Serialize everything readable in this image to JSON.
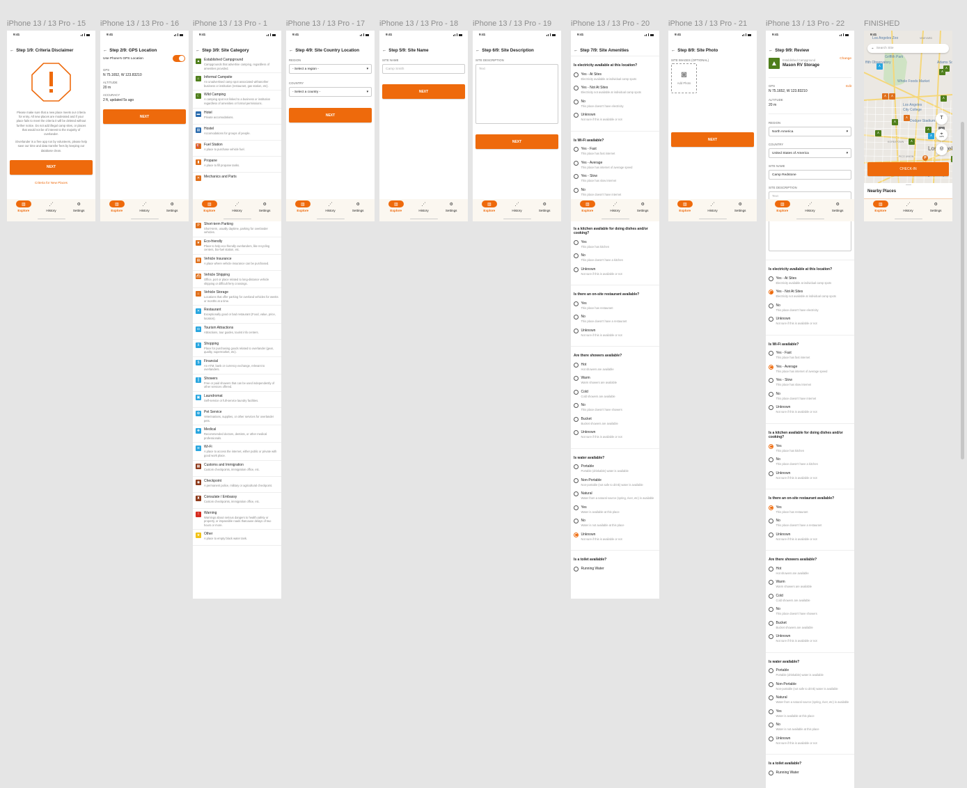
{
  "canvas_bg": "#e5e5e5",
  "accent": "#ee6a0c",
  "status_time": "9:41",
  "nav": [
    {
      "label": "Explore",
      "icon": "map-book-icon",
      "active": true
    },
    {
      "label": "History",
      "icon": "route-icon",
      "active": false
    },
    {
      "label": "Settings",
      "icon": "gear-icon",
      "active": false
    }
  ],
  "amenity_questions": [
    {
      "q": "Is electricity available at this location?",
      "options": [
        {
          "label": "Yes - At Sites",
          "desc": "Electricity available at individual camp spots"
        },
        {
          "label": "Yes - Not At Sites",
          "desc": "Electricity not available at individual camp spots"
        },
        {
          "label": "No",
          "desc": "This place doesn't have electricity"
        },
        {
          "label": "Unknown",
          "desc": "Not sure if this is available or not"
        }
      ]
    },
    {
      "q": "Is Wi-Fi available?",
      "options": [
        {
          "label": "Yes - Fast",
          "desc": "This place has fast internet"
        },
        {
          "label": "Yes - Average",
          "desc": "This place has internet of average speed"
        },
        {
          "label": "Yes - Slow",
          "desc": "This place has slow internet"
        },
        {
          "label": "No",
          "desc": "This place doesn't have internet"
        },
        {
          "label": "Unknown",
          "desc": "Not sure if this is available or not"
        }
      ]
    },
    {
      "q": "Is a kitchen available for doing dishes and/or cooking?",
      "options": [
        {
          "label": "Yes",
          "desc": "This place has kitchen"
        },
        {
          "label": "No",
          "desc": "This place doesn't have a kitchen"
        },
        {
          "label": "Unknown",
          "desc": "Not sure if this is available or not"
        }
      ]
    },
    {
      "q": "Is there an on-site restaurant available?",
      "options": [
        {
          "label": "Yes",
          "desc": "This place has restaurant"
        },
        {
          "label": "No",
          "desc": "This place doesn't have a restaurant"
        },
        {
          "label": "Unknown",
          "desc": "Not sure if this is available or not"
        }
      ]
    },
    {
      "q": "Are there showers available?",
      "options": [
        {
          "label": "Hot",
          "desc": "Hot showers are available"
        },
        {
          "label": "Warm",
          "desc": "Warm showers are available"
        },
        {
          "label": "Cold",
          "desc": "Cold showers are available"
        },
        {
          "label": "No",
          "desc": "This place doesn't have showers"
        },
        {
          "label": "Bucket",
          "desc": "Bucket showers are available"
        },
        {
          "label": "Unknown",
          "desc": "Not sure if this is available or not"
        }
      ]
    },
    {
      "q": "Is water available?",
      "options": [
        {
          "label": "Portable",
          "desc": "Portable (drinkable) water is available"
        },
        {
          "label": "Non-Portable",
          "desc": "Non-portable (not safe to drink) water is available"
        },
        {
          "label": "Natural",
          "desc": "Water from a natural source (spring, river, etc) is available"
        },
        {
          "label": "Yes",
          "desc": "Water is available at this place"
        },
        {
          "label": "No",
          "desc": "Water is not available at this place"
        },
        {
          "label": "Unknown",
          "desc": "Not sure if this is available or not"
        }
      ]
    },
    {
      "q": "Is a toilet available?",
      "options": [
        {
          "label": "Running Water",
          "desc": ""
        }
      ]
    }
  ],
  "frames": [
    {
      "type": "disclaimer",
      "label": "iPhone 13 / 13 Pro - 15",
      "title": "Step 1/9: Criteria Disclaimer",
      "paragraphs": [
        "Please make sure that a new place meets our criteria for entry. All new places are moderated and if your place fails to meet the criteria it will be deleted without further notice. Do not add illegal camp sites, or places that would not be of interest to the majority of overlander.",
        "iOverlander is a free app run by volunteers, please help save our time and data transfer fees by keeping our database clean."
      ],
      "button": "NEXT",
      "link": "Criteria for New Places"
    },
    {
      "type": "gps",
      "label": "iPhone 13 / 13 Pro - 16",
      "title": "Step 2/9: GPS Location",
      "toggle_label": "Use Phone's GPS Location",
      "toggle_on": true,
      "fields": [
        {
          "label": "GPS",
          "value": "N 75.1652, W 123.83210"
        },
        {
          "label": "ALTITUDE",
          "value": "20 m"
        },
        {
          "label": "ACCURACY",
          "value": "2 ft, updated 5s ago"
        }
      ],
      "button": "NEXT"
    },
    {
      "type": "category",
      "label": "iPhone 13 / 13 Pro - 1",
      "title": "Step 3/9: Site Category",
      "items": [
        {
          "name": "Established Campground",
          "desc": "Campgrounds that advertise camping, regardless of amenities provided.",
          "icon": "tent-icon",
          "color": "#4f7f1c"
        },
        {
          "name": "Informal Campsite",
          "desc": "An unadvertised camp spot associated withanother business or institution (restaurant, gas station, etc).",
          "icon": "campsite-icon",
          "color": "#4f7f1c"
        },
        {
          "name": "Wild Camping",
          "desc": "A camping spot not linked to a business or institution regardless of amenities or formal permissions.",
          "icon": "wild-camping-icon",
          "color": "#4f7f1c"
        },
        {
          "name": "Hotel",
          "desc": "Private accomodations.",
          "icon": "bed-icon",
          "color": "#2b6cae"
        },
        {
          "name": "Hostel",
          "desc": "Accomodations for groups of people.",
          "icon": "hostel-icon",
          "color": "#2b6cae"
        },
        {
          "name": "Fuel Station",
          "desc": "A place to purchase vehicle fuel.",
          "icon": "fuel-icon",
          "color": "#e0701b"
        },
        {
          "name": "Propane",
          "desc": "A place to fill propane tanks.",
          "icon": "propane-icon",
          "color": "#e0701b"
        },
        {
          "name": "Mechanics and Parts",
          "desc": "",
          "icon": "wrench-icon",
          "color": "#e0701b"
        },
        {
          "name": "Sanitation Dump Station",
          "desc": "A place to empty black water tank.",
          "icon": "dump-station-icon",
          "color": "#e0701b"
        },
        {
          "name": "Short-term Parking",
          "desc": "Short-term, usually daytime, parking for overlander vehicles.",
          "icon": "parking-icon",
          "color": "#e0701b"
        },
        {
          "name": "Eco-friendly",
          "desc": "Place to help eco-friendly overlanders, like recycling centers, bio-fuel station, etc.",
          "icon": "leaf-icon",
          "color": "#e0701b"
        },
        {
          "name": "Vehicle Insurance",
          "desc": "A place where vehicle insurance can be purchased.",
          "icon": "document-icon",
          "color": "#e0701b"
        },
        {
          "name": "Vehicle Shipping",
          "desc": "Office, port or place related to long-distance vehicle shipping or difficult ferry crossings.",
          "icon": "ship-icon",
          "color": "#e0701b"
        },
        {
          "name": "Vehicle Storage",
          "desc": "Locations that offer parking for overland vehicles for weeks or months at a time.",
          "icon": "garage-icon",
          "color": "#e0701b"
        },
        {
          "name": "Restaurant",
          "desc": "Exceptionally good or bad restaurant (Food, value, price, location).",
          "icon": "restaurant-icon",
          "color": "#29a6df"
        },
        {
          "name": "Tourism Attractions",
          "desc": "Attractions, tour guides, tourist info centers.",
          "icon": "camera-icon",
          "color": "#29a6df"
        },
        {
          "name": "Shopping",
          "desc": "Place for purchasing goods related to overlander (gear, quality, supermarket, etc).",
          "icon": "cart-icon",
          "color": "#29a6df"
        },
        {
          "name": "Financial",
          "desc": "An ATM, bank or currency exchange, relevant to overlanders.",
          "icon": "dollar-icon",
          "color": "#29a6df"
        },
        {
          "name": "Showers",
          "desc": "Free or paid showers that can be used independently of other services offered.",
          "icon": "shower-icon",
          "color": "#29a6df"
        },
        {
          "name": "Laundromat",
          "desc": "Self-service or full-service laundry facilities.",
          "icon": "laundry-icon",
          "color": "#29a6df"
        },
        {
          "name": "Pet Service",
          "desc": "Veterinarians, supplies, or other services for overlander pets.",
          "icon": "paw-icon",
          "color": "#29a6df"
        },
        {
          "name": "Medical",
          "desc": "Recommended doctors, dentists, or other medical professionals.",
          "icon": "medical-icon",
          "color": "#29a6df"
        },
        {
          "name": "Wi-Fi",
          "desc": "A place to access the internet, either public or private with good work place.",
          "icon": "wifi-icon",
          "color": "#29a6df"
        },
        {
          "name": "Customs and Immigration",
          "desc": "Custom checkpoints, immigration office, etc.",
          "icon": "customs-icon",
          "color": "#8e3b1c"
        },
        {
          "name": "Checkpoint",
          "desc": "A permanent police, military or agricultural checkpoint.",
          "icon": "checkpoint-icon",
          "color": "#8e3b1c"
        },
        {
          "name": "Consulate / Embassy",
          "desc": "Custom checkpoints, immigration office, etc.",
          "icon": "embassy-icon",
          "color": "#8e3b1c"
        },
        {
          "name": "Warning",
          "desc": "Warnings about serious dangers to health,safety or property, or impassible roads thatcause delays of two hours or more.",
          "icon": "warning-icon",
          "color": "#d62b1f"
        },
        {
          "name": "Other",
          "desc": "A place to empty black water tank.",
          "icon": "star-icon",
          "color": "#f2c318"
        }
      ]
    },
    {
      "type": "country",
      "label": "iPhone 13 / 13 Pro - 17",
      "title": "Step 4/9: Site Country Location",
      "region_label": "REGION",
      "region_value": "- Select a region -",
      "country_label": "COUNTRY",
      "country_value": "- Select a country -",
      "button": "NEXT"
    },
    {
      "type": "name",
      "label": "iPhone 13 / 13 Pro - 18",
      "title": "Step 5/9: Site Name",
      "field_label": "SITE NAME",
      "placeholder": "Camp Smith",
      "button": "NEXT"
    },
    {
      "type": "description",
      "label": "iPhone 13 / 13 Pro - 19",
      "title": "Step 6/9: Site Description",
      "field_label": "SITE DESCRIPTION",
      "placeholder": "Text",
      "button": "NEXT"
    },
    {
      "type": "amenities",
      "label": "iPhone 13 / 13 Pro - 20",
      "title": "Step 7/9: Site Amenities",
      "selections": [
        null,
        null,
        null,
        null,
        null,
        5,
        null
      ]
    },
    {
      "type": "photo",
      "label": "iPhone 13 / 13 Pro - 21",
      "title": "Step 8/9: Site Photo",
      "field_label": "SITE IMAGES (OPTIONAL)",
      "add_photo": "Add Photo",
      "button": "NEXT"
    },
    {
      "type": "review",
      "label": "iPhone 13 / 13 Pro - 22",
      "title": "Step 9/9: Review",
      "category": "Established Campground",
      "site": "Mason RV Storage",
      "change": "Change",
      "edit": "Edit",
      "gps_label": "GPS",
      "gps_value": "N 75.1652, W 123.83210",
      "alt_label": "ALTITUDE",
      "alt_value": "20 m",
      "region_label": "REGION",
      "region_value": "North America",
      "country_label": "COUNTRY",
      "country_value": "United States of America",
      "name_label": "SITE NAME",
      "name_value": "Camp Redstone",
      "desc_label": "SITE DESCRIPTION",
      "desc_placeholder": "Text",
      "selections": [
        1,
        1,
        0,
        0,
        null,
        null,
        null
      ]
    },
    {
      "type": "map",
      "label": "FINISHED",
      "search_placeholder": "Search Site",
      "checkin": "CHECK-IN",
      "nearby": "Nearby Places",
      "map_labels": [
        "Los Angeles Zoo",
        "Griffith Park",
        "ffith Observatory",
        "Adams Squ",
        "Whole Foods Market",
        "Los Angeles",
        "City College",
        "Dodger Stadium",
        "KOREATOWN",
        "PICO UNION",
        "Los Angel",
        "Night Gallery",
        "VINEYARD",
        "GPS"
      ]
    }
  ]
}
